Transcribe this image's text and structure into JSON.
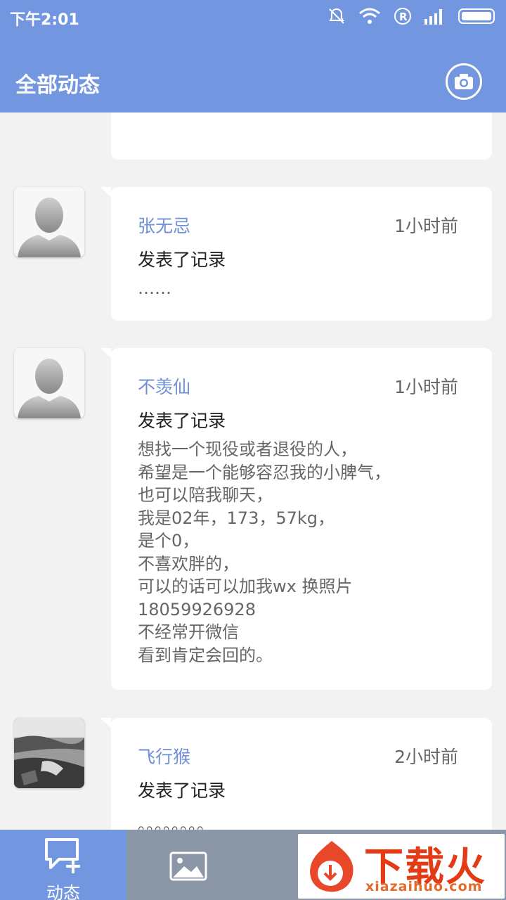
{
  "status_bar": {
    "time": "下午2:01"
  },
  "header": {
    "title": "全部动态",
    "camera_icon": "camera-icon"
  },
  "feed": {
    "partial_text": "",
    "posts": [
      {
        "name": "张无忌",
        "ago": "1小时前",
        "action": "发表了记录",
        "content": "……",
        "avatar": "default-avatar"
      },
      {
        "name": "不羡仙",
        "ago": "1小时前",
        "action": "发表了记录",
        "content": "想找一个现役或者退役的人，\n希望是一个能够容忍我的小脾气，\n也可以陪我聊天，\n我是02年，173，57kg，\n是个0，\n不喜欢胖的，\n可以的话可以加我wx  换照片\n18059926928\n不经常开微信\n看到肯定会回的。",
        "avatar": "default-avatar"
      },
      {
        "name": "飞行猴",
        "ago": "2小时前",
        "action": "发表了记录",
        "content": "。。。。。。。。",
        "avatar": "photo-avatar"
      }
    ]
  },
  "tabbar": {
    "tabs": [
      {
        "label": "动态",
        "icon": "chat-add-icon",
        "active": true
      },
      {
        "label": "",
        "icon": "image-icon",
        "active": false
      }
    ]
  },
  "watermark": {
    "brand": "下载火",
    "domain": "xiazaihuo.com"
  },
  "colors": {
    "primary": "#7396e0",
    "name": "#6f8fd6",
    "tabbar": "#8b96a6",
    "watermark": "#e33b16"
  }
}
